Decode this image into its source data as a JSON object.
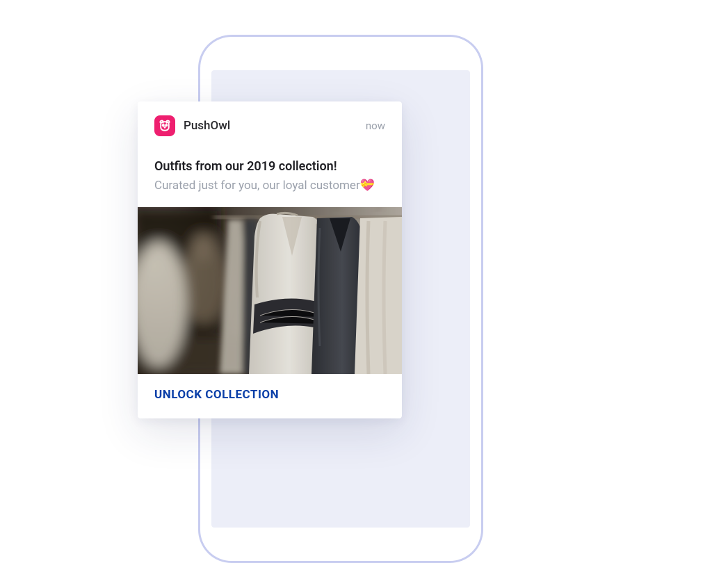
{
  "notification": {
    "app_name": "PushOwl",
    "timestamp": "now",
    "title": "Outfits from our 2019 collection!",
    "subtitle": "Curated just for you, our loyal customer",
    "emoji": "💝",
    "action_label": "UNLOCK COLLECTION",
    "image_alt": "Clothing rack with outfits"
  },
  "colors": {
    "brand_pink": "#ee1f6f",
    "action_blue": "#0a3fa8",
    "muted_text": "#9aa0ab",
    "phone_border": "#c8cdf0",
    "phone_screen": "#eceef8"
  }
}
